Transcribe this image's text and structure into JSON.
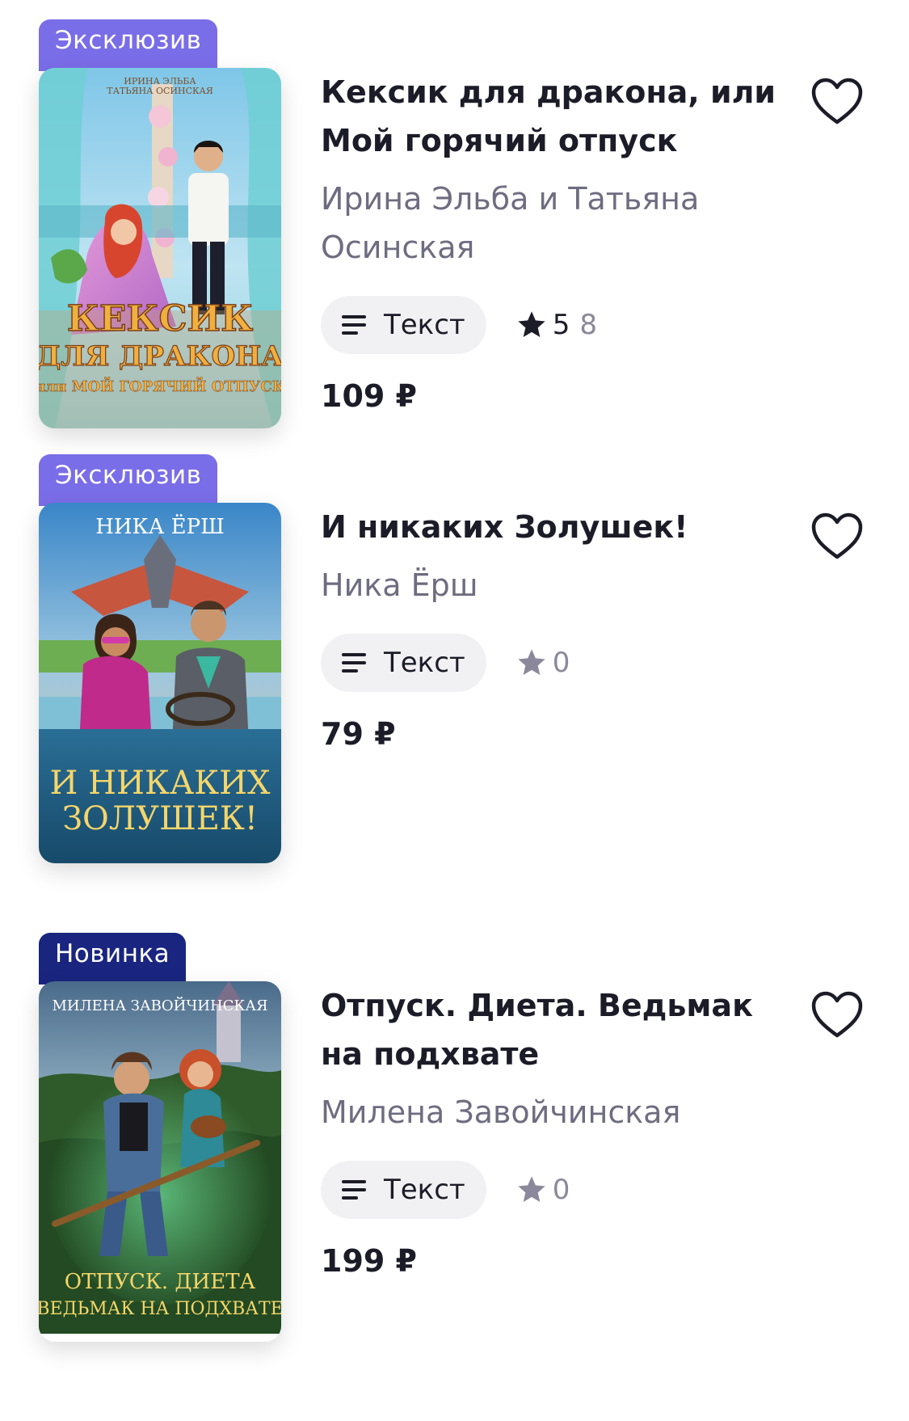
{
  "colors": {
    "badge_exclusive": "#7a6de8",
    "badge_new": "#1a2580",
    "title": "#1c1c28",
    "author": "#6e6c80",
    "chip_bg": "#f1f1f4"
  },
  "books": [
    {
      "badge": "Эксклюзив",
      "badge_kind": "exclusive",
      "title": "Кексик для дракона, или Мой горячий отпуск",
      "author": "Ирина Эльба и Татьяна Осинская",
      "format": "Текст",
      "format_icon": "text-lines-icon",
      "rating": "5",
      "rating_count": "8",
      "rating_filled": true,
      "price": "109 ₽",
      "cover": {
        "top_text_1": "ИРИНА ЭЛЬБА",
        "top_text_2": "ТАТЬЯНА ОСИНСКАЯ",
        "title_1": "КЕКСИК",
        "title_2": "ДЛЯ ДРАКОНА",
        "title_3": "или МОЙ ГОРЯЧИЙ ОТПУСК"
      }
    },
    {
      "badge": "Эксклюзив",
      "badge_kind": "exclusive",
      "title": "И никаких Золушек!",
      "author": "Ника Ёрш",
      "format": "Текст",
      "format_icon": "text-lines-icon",
      "rating": "",
      "rating_count": "0",
      "rating_filled": false,
      "price": "79 ₽",
      "cover": {
        "top_text_1": "НИКА ЁРШ",
        "title_1": "И НИКАКИХ",
        "title_2": "ЗОЛУШЕК!"
      }
    },
    {
      "badge": "Новинка",
      "badge_kind": "new",
      "title": "Отпуск. Диета. Ведьмак на подхвате",
      "author": "Милена Завойчинская",
      "format": "Текст",
      "format_icon": "text-lines-icon",
      "rating": "",
      "rating_count": "0",
      "rating_filled": false,
      "price": "199 ₽",
      "cover": {
        "top_text_1": "МИЛЕНА ЗАВОЙЧИНСКАЯ",
        "title_1": "ОТПУСК. ДИЕТА",
        "title_2": "ВЕДЬМАК НА ПОДХВАТЕ"
      }
    }
  ]
}
